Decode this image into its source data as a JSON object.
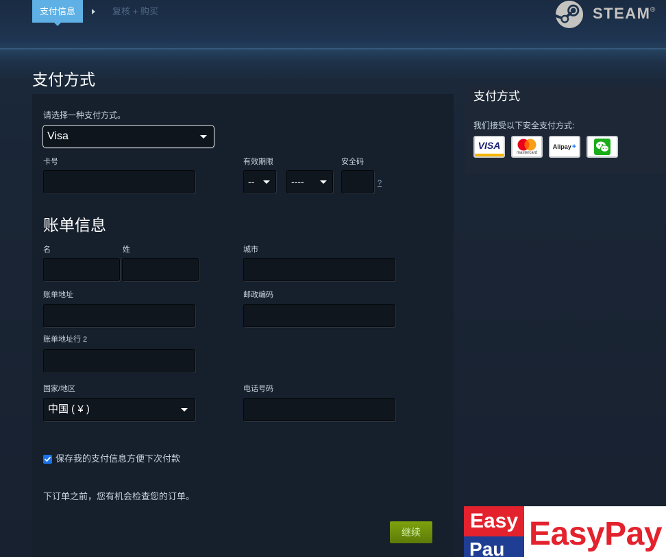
{
  "header": {
    "steps": [
      {
        "label": "支付信息",
        "active": true
      },
      {
        "label": "复核 + 购买",
        "active": false
      }
    ],
    "step_separator_icon": "chevron-right-icon",
    "logo": {
      "icon": "steam-logo-icon",
      "wordmark": "STEAM",
      "registered_mark": "®"
    }
  },
  "page_title": "支付方式",
  "payment": {
    "method_prompt": "请选择一种支付方式。",
    "method_selected": "Visa",
    "card_number_label": "卡号",
    "expiry_label": "有效期限",
    "expiry_month_selected": "--",
    "expiry_year_selected": "----",
    "security_code_label": "安全码",
    "security_code_help": "?"
  },
  "billing": {
    "title": "账单信息",
    "first_name_label": "名",
    "last_name_label": "姓",
    "city_label": "城市",
    "address_label": "账单地址",
    "postal_code_label": "邮政编码",
    "address_line2_label": "账单地址行 2",
    "country_label": "国家/地区",
    "country_selected": "中国 ( ¥ )",
    "phone_label": "电话号码"
  },
  "save_payment_info": {
    "checked": true,
    "label": "保存我的支付信息方便下次付款"
  },
  "review_note": "下订单之前，您有机会检查您的订单。",
  "continue_button": "继续",
  "sidebar": {
    "title": "支付方式",
    "accepted_text": "我们接受以下安全支付方式:",
    "methods": [
      {
        "icon": "visa-icon",
        "label": "VISA"
      },
      {
        "icon": "mastercard-icon",
        "label": "mastercard"
      },
      {
        "icon": "alipay-plus-icon",
        "label": "Alipay"
      },
      {
        "icon": "wechat-pay-icon"
      }
    ]
  },
  "ad_banner": {
    "logo_top": "Easy",
    "logo_bottom": "Pau",
    "wordmark": "EasyPay"
  },
  "colors": {
    "active_step": "#5fb0e4",
    "inactive_step_text": "#4e6a87",
    "continue_button_top": "#7ea20e",
    "continue_button_bottom": "#5b7b08",
    "continue_text": "#d2efa9",
    "checkbox": "#1a73e8",
    "ad_red": "#e3222d",
    "ad_blue": "#1f3e93"
  }
}
